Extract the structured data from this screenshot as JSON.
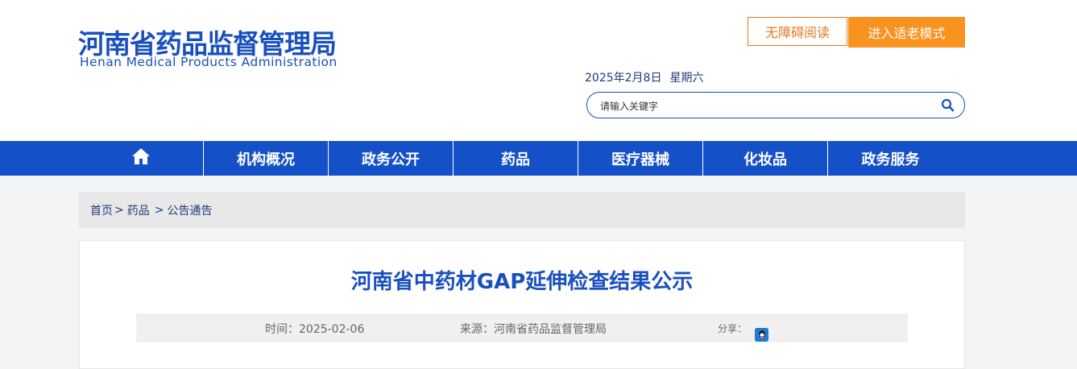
{
  "header": {
    "logo_cn": "河南省药品监督管理局",
    "logo_en": "Henan Medical Products Administration",
    "accessible_button": "无障碍阅读",
    "elder_mode_button": "进入适老模式",
    "date": "2025年2月8日",
    "weekday": "星期六",
    "search": {
      "placeholder": "请输入关键字",
      "icon": "search-icon"
    }
  },
  "nav": {
    "home_icon": "home-icon",
    "items": [
      {
        "label": "机构概况"
      },
      {
        "label": "政务公开"
      },
      {
        "label": "药品"
      },
      {
        "label": "医疗器械"
      },
      {
        "label": "化妆品"
      },
      {
        "label": "政务服务"
      }
    ]
  },
  "breadcrumb": {
    "items": [
      {
        "label": "首页"
      },
      {
        "label": "药品"
      },
      {
        "label": "公告通告"
      }
    ],
    "separator": ">"
  },
  "article": {
    "title": "河南省中药材GAP延伸检查结果公示",
    "time": "时间：2025-02-06",
    "source": "来源：河南省药品监督管理局",
    "share_label": "分享：",
    "share_icons": [
      "wechat-icon",
      "weibo-icon",
      "qq-icon"
    ]
  },
  "colors": {
    "brand_blue": "#1450c8",
    "accent_orange": "#f7931e"
  }
}
